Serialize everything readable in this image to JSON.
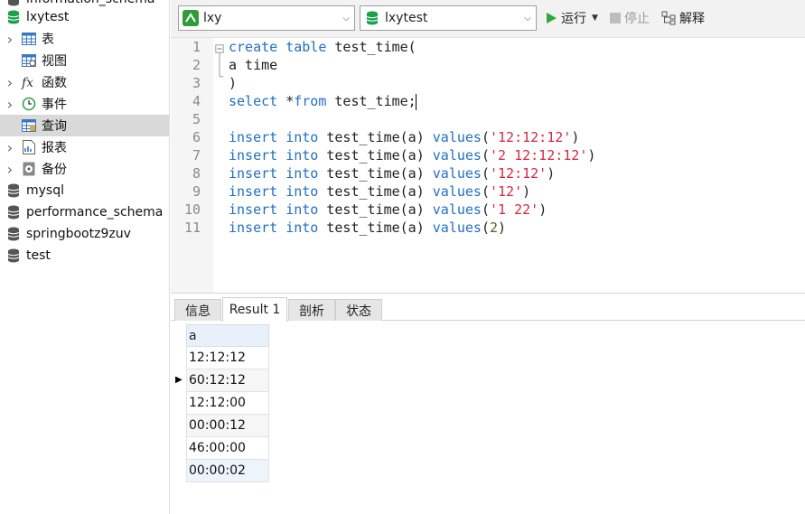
{
  "sidebar": {
    "partial_top_label": "information_schema",
    "current_db": "lxytest",
    "children": [
      {
        "label": "表",
        "icon": "table-icon",
        "expandable": true
      },
      {
        "label": "视图",
        "icon": "view-icon",
        "expandable": false
      },
      {
        "label": "函数",
        "icon": "function-icon",
        "expandable": true
      },
      {
        "label": "事件",
        "icon": "event-icon",
        "expandable": true
      },
      {
        "label": "查询",
        "icon": "query-icon",
        "expandable": false,
        "selected": true
      },
      {
        "label": "报表",
        "icon": "report-icon",
        "expandable": true
      },
      {
        "label": "备份",
        "icon": "backup-icon",
        "expandable": true
      }
    ],
    "databases": [
      "mysql",
      "performance_schema",
      "springbootz9zuv",
      "test"
    ]
  },
  "toolbar": {
    "connection": "lxy",
    "database": "lxytest",
    "run_label": "运行",
    "stop_label": "停止",
    "explain_label": "解释"
  },
  "editor": {
    "line_numbers": [
      "1",
      "2",
      "3",
      "4",
      "5",
      "6",
      "7",
      "8",
      "9",
      "10",
      "11"
    ],
    "lines": [
      [
        {
          "t": "create table",
          "c": "kw"
        },
        {
          "t": " test_time(",
          "c": ""
        }
      ],
      [
        {
          "t": "a time",
          "c": ""
        }
      ],
      [
        {
          "t": ")",
          "c": ""
        }
      ],
      [
        {
          "t": "select",
          "c": "kw"
        },
        {
          "t": " *",
          "c": ""
        },
        {
          "t": "from",
          "c": "kw"
        },
        {
          "t": " test_time;",
          "c": ""
        }
      ],
      [],
      [
        {
          "t": "insert into",
          "c": "kw"
        },
        {
          "t": " test_time(a) ",
          "c": ""
        },
        {
          "t": "values",
          "c": "kw"
        },
        {
          "t": "(",
          "c": ""
        },
        {
          "t": "'12:12:12'",
          "c": "str"
        },
        {
          "t": ")",
          "c": ""
        }
      ],
      [
        {
          "t": "insert into",
          "c": "kw"
        },
        {
          "t": " test_time(a) ",
          "c": ""
        },
        {
          "t": "values",
          "c": "kw"
        },
        {
          "t": "(",
          "c": ""
        },
        {
          "t": "'2 12:12:12'",
          "c": "str"
        },
        {
          "t": ")",
          "c": ""
        }
      ],
      [
        {
          "t": "insert into",
          "c": "kw"
        },
        {
          "t": " test_time(a) ",
          "c": ""
        },
        {
          "t": "values",
          "c": "kw"
        },
        {
          "t": "(",
          "c": ""
        },
        {
          "t": "'12:12'",
          "c": "str"
        },
        {
          "t": ")",
          "c": ""
        }
      ],
      [
        {
          "t": "insert into",
          "c": "kw"
        },
        {
          "t": " test_time(a) ",
          "c": ""
        },
        {
          "t": "values",
          "c": "kw"
        },
        {
          "t": "(",
          "c": ""
        },
        {
          "t": "'12'",
          "c": "str"
        },
        {
          "t": ")",
          "c": ""
        }
      ],
      [
        {
          "t": "insert into",
          "c": "kw"
        },
        {
          "t": " test_time(a) ",
          "c": ""
        },
        {
          "t": "values",
          "c": "kw"
        },
        {
          "t": "(",
          "c": ""
        },
        {
          "t": "'1 22'",
          "c": "str"
        },
        {
          "t": ")",
          "c": ""
        }
      ],
      [
        {
          "t": "insert into",
          "c": "kw"
        },
        {
          "t": " test_time(a) ",
          "c": ""
        },
        {
          "t": "values",
          "c": "kw"
        },
        {
          "t": "(",
          "c": ""
        },
        {
          "t": "2",
          "c": "num"
        },
        {
          "t": ")",
          "c": ""
        }
      ]
    ]
  },
  "results": {
    "tabs": [
      {
        "label": "信息",
        "active": false
      },
      {
        "label": "Result 1",
        "active": true
      },
      {
        "label": "剖析",
        "active": false
      },
      {
        "label": "状态",
        "active": false
      }
    ],
    "columns": [
      "a"
    ],
    "rows": [
      "12:12:12",
      "60:12:12",
      "12:12:00",
      "00:00:12",
      "46:00:00",
      "00:00:02"
    ],
    "current_row_index": 1
  },
  "colors": {
    "keyword": "#1f6fc5",
    "string": "#d8263e",
    "db_icon": "#1aa34a",
    "run_icon": "#2eaa3b",
    "selection": "#d9d9d9"
  }
}
